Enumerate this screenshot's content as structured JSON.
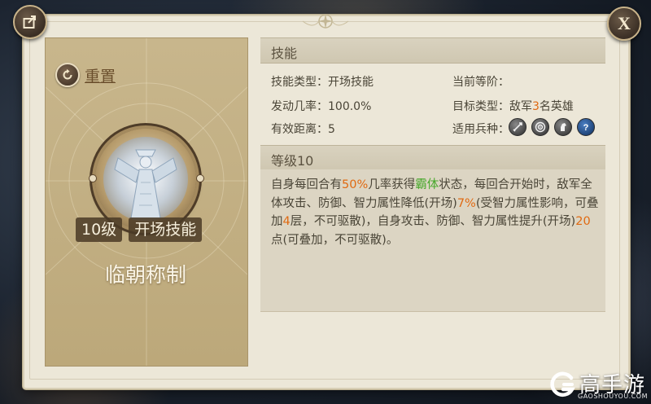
{
  "hero": {
    "reset_label": "重置",
    "level_badge": "10级",
    "type_badge": "开场技能",
    "skill_name": "临朝称制"
  },
  "skill_section": {
    "title": "技能",
    "skill_type_label": "技能类型：",
    "skill_type_value": "开场技能",
    "trigger_rate_label": "发动几率：",
    "trigger_rate_value": "100.0%",
    "range_label": "有效距离：",
    "range_value": "5",
    "current_rank_label": "当前等阶：",
    "current_rank_value": "",
    "target_type_label": "目标类型：",
    "target_prefix": "敌军",
    "target_count": "3",
    "target_suffix": "名英雄",
    "unit_types_label": "适用兵种：",
    "unit_icons": [
      "sword-icon",
      "bow-target-icon",
      "horse-icon",
      "help-icon"
    ]
  },
  "level_section": {
    "title": "等级10",
    "desc_parts": [
      {
        "text": "自身每回合有",
        "style": "normal"
      },
      {
        "text": "50%",
        "style": "orange"
      },
      {
        "text": "几率获得",
        "style": "normal"
      },
      {
        "text": "霸体",
        "style": "green"
      },
      {
        "text": "状态，每回合开始时，敌军全体攻击、防御、智力属性降低(开场)",
        "style": "normal"
      },
      {
        "text": "7%",
        "style": "orange"
      },
      {
        "text": "(受智力属性影响，可叠加",
        "style": "normal"
      },
      {
        "text": "4",
        "style": "orange"
      },
      {
        "text": "层，不可驱散)，自身攻击、防御、智力属性提升(开场)",
        "style": "normal"
      },
      {
        "text": "20",
        "style": "orange"
      },
      {
        "text": "点(可叠加，不可驱散)。",
        "style": "normal"
      }
    ]
  },
  "watermark": {
    "brand": "高手游",
    "url": "GAOSHOUYOU.COM"
  },
  "colors": {
    "highlight_orange": "#e06a12",
    "highlight_green": "#48a82c",
    "panel_bg": "#ece7d8",
    "card_bg": "#c8b68c"
  }
}
